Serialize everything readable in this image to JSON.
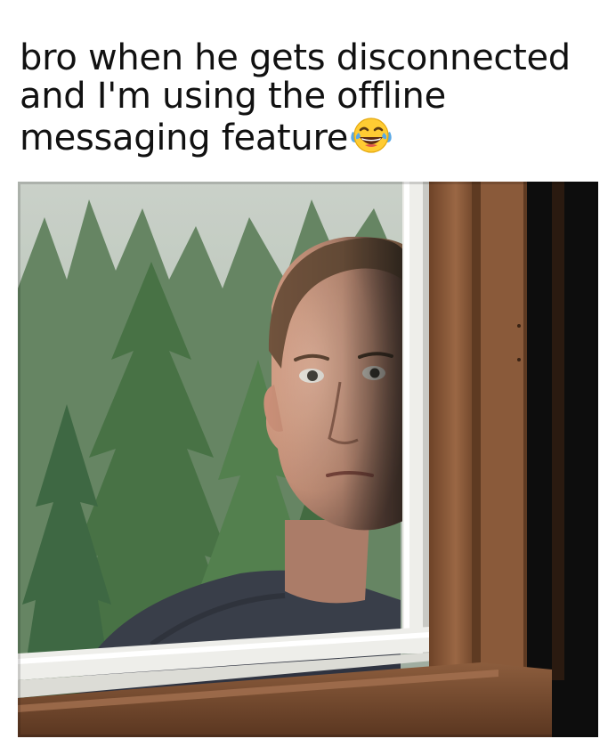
{
  "caption": {
    "line1": "bro when he gets disconnected",
    "line2": "and I'm using the offline",
    "line3": "messaging feature",
    "emoji": "face-with-tears-of-joy-icon"
  },
  "colors": {
    "background": "#ffffff",
    "text": "#111111",
    "trees": "#3f6b3c",
    "window_frame": "#f1f1ee",
    "wood": "#8a5a3a",
    "dark_interior": "#0d0d0d",
    "shirt": "#2f3340",
    "skin": "#d49a82"
  }
}
